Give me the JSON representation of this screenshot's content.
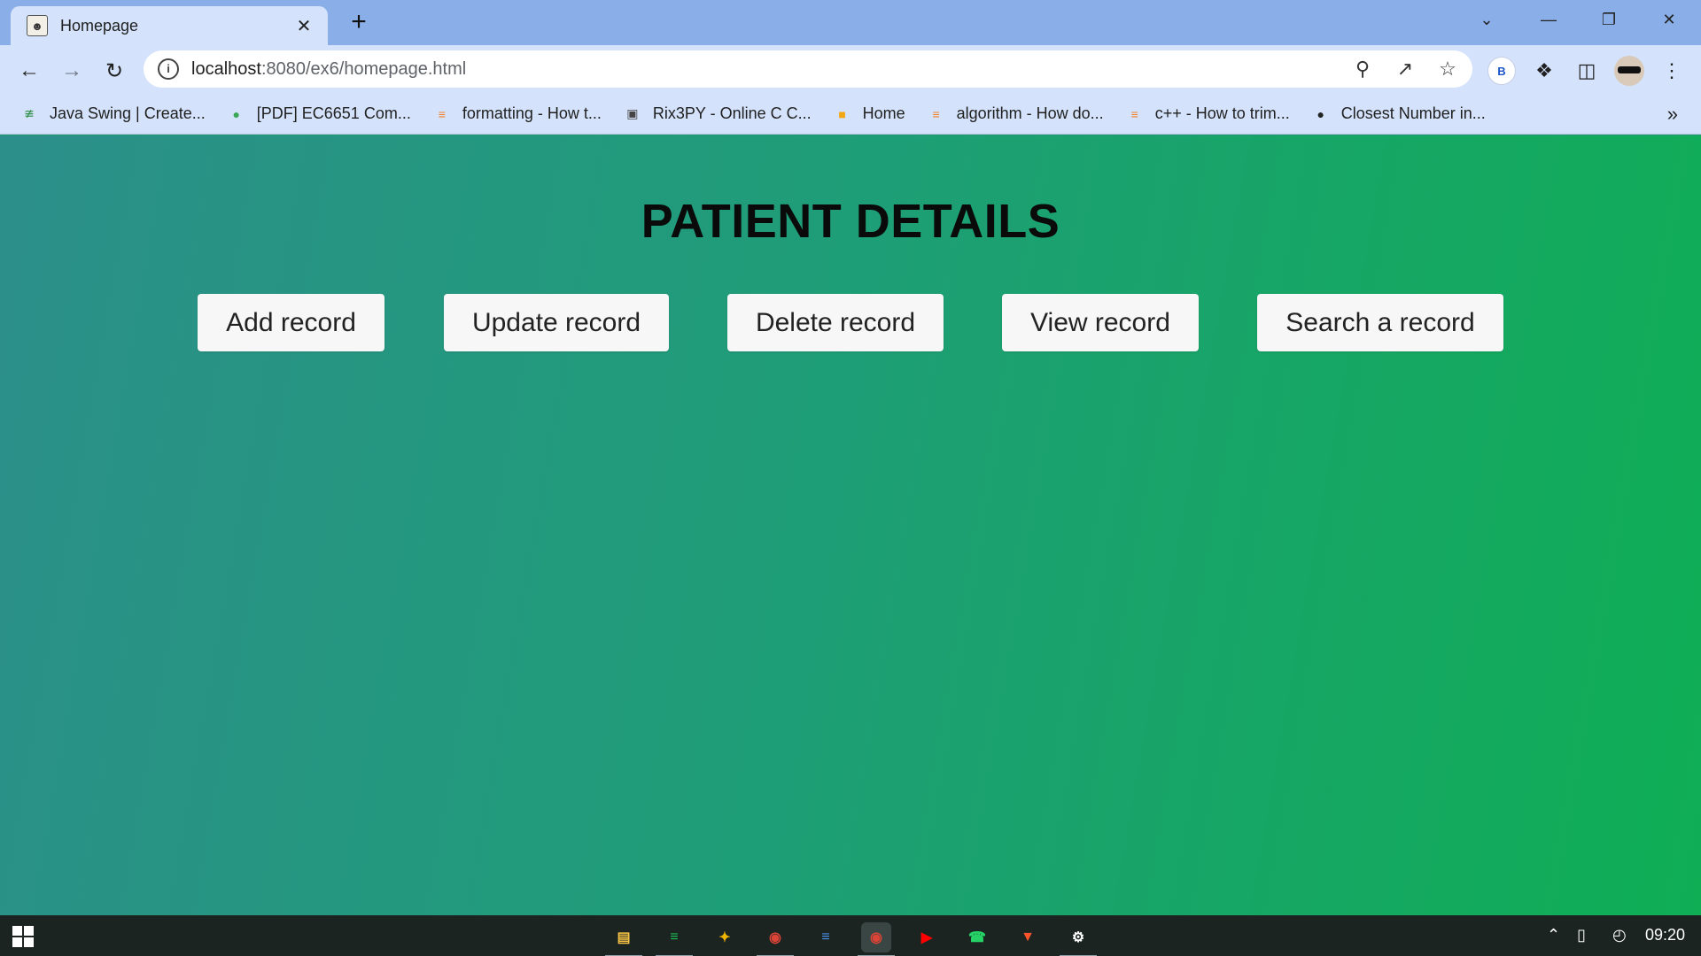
{
  "browser": {
    "tab": {
      "title": "Homepage",
      "favicon": "tomcat-icon"
    },
    "address": {
      "host": "localhost",
      "path": ":8080/ex6/homepage.html"
    },
    "profile_initial": "B",
    "bookmarks": [
      {
        "label": "Java Swing | Create...",
        "icon": "geeksforgeeks-icon",
        "color": "#2f8d46"
      },
      {
        "label": "[PDF] EC6651 Com...",
        "icon": "globe-color-icon",
        "color": "#3aa757"
      },
      {
        "label": "formatting - How t...",
        "icon": "stackoverflow-icon",
        "color": "#f48024"
      },
      {
        "label": "Rix3PY - Online C C...",
        "icon": "ideone-icon",
        "color": "#444444"
      },
      {
        "label": "Home",
        "icon": "box-icon",
        "color": "#f3a712"
      },
      {
        "label": "algorithm - How do...",
        "icon": "stackoverflow-icon",
        "color": "#f48024"
      },
      {
        "label": "c++ - How to trim...",
        "icon": "stackoverflow-icon",
        "color": "#f48024"
      },
      {
        "label": "Closest Number in...",
        "icon": "globe-icon",
        "color": "#222222"
      }
    ],
    "more_bookmarks": "»"
  },
  "page": {
    "title": "PATIENT DETAILS",
    "buttons": [
      {
        "label": "Add record"
      },
      {
        "label": "Update record"
      },
      {
        "label": "Delete record"
      },
      {
        "label": "View record"
      },
      {
        "label": "Search a record"
      }
    ],
    "background_colors": [
      "#2c8f8a",
      "#0fae55"
    ]
  },
  "taskbar": {
    "apps": [
      {
        "name": "file-explorer-icon",
        "color": "#f6c344"
      },
      {
        "name": "spotify-icon",
        "color": "#1db954"
      },
      {
        "name": "pinned-app-icon",
        "color": "#f0b400"
      },
      {
        "name": "chrome-icon",
        "color": "#db4437"
      },
      {
        "name": "spotify-alt-icon",
        "color": "#4a90e2"
      },
      {
        "name": "chrome-active-icon",
        "color": "#db4437"
      },
      {
        "name": "youtube-icon",
        "color": "#ff0000"
      },
      {
        "name": "whatsapp-icon",
        "color": "#25d366"
      },
      {
        "name": "brave-icon",
        "color": "#fb542b"
      },
      {
        "name": "settings-icon",
        "color": "#ffffff"
      }
    ],
    "clock": "09:20"
  }
}
